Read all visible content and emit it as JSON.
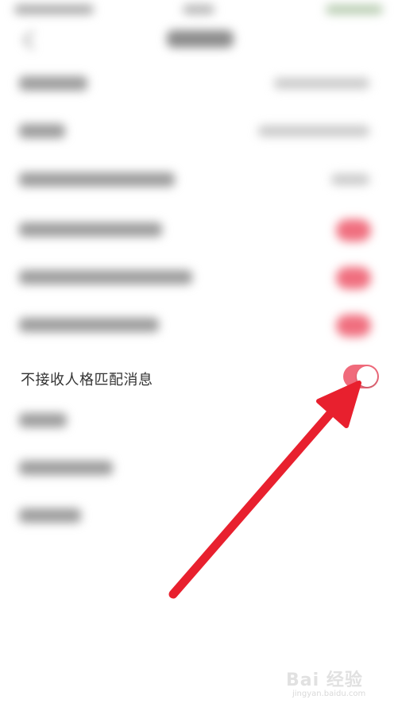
{
  "focused_setting": {
    "label": "不接收人格匹配消息",
    "toggle_on": true
  },
  "colors": {
    "toggle_on": "#f06a7b",
    "annotation_arrow": "#e8202e",
    "text": "#333333"
  },
  "watermark": {
    "logo": "Bai 经验",
    "url": "jingyan.baidu.com"
  }
}
